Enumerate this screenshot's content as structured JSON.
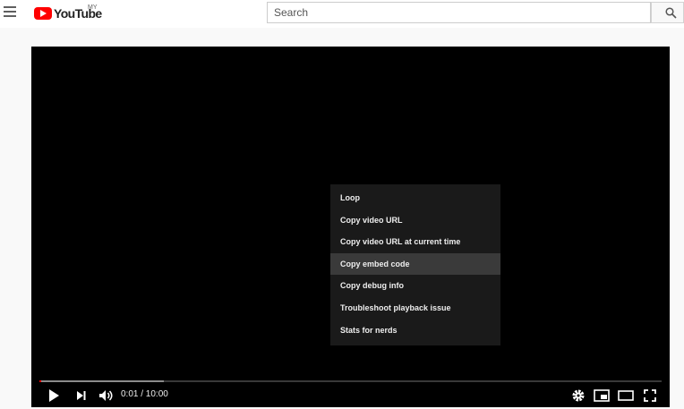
{
  "header": {
    "logo_text": "YouTube",
    "logo_region": "MY",
    "search_placeholder": "Search",
    "menu_icon": "hamburger-menu-icon",
    "search_icon": "search-icon"
  },
  "player": {
    "context_menu": {
      "items": [
        {
          "label": "Loop"
        },
        {
          "label": "Copy video URL"
        },
        {
          "label": "Copy video URL at current time"
        },
        {
          "label": "Copy embed code"
        },
        {
          "label": "Copy debug info"
        },
        {
          "label": "Troubleshoot playback issue"
        },
        {
          "label": "Stats for nerds"
        }
      ],
      "highlighted_index": 3
    },
    "controls": {
      "time_display": "0:01 / 10:00",
      "played_fraction": 0.0017,
      "loaded_fraction": 0.2
    },
    "colors": {
      "progress": "#ff0000",
      "brand": "#ff0000"
    }
  }
}
